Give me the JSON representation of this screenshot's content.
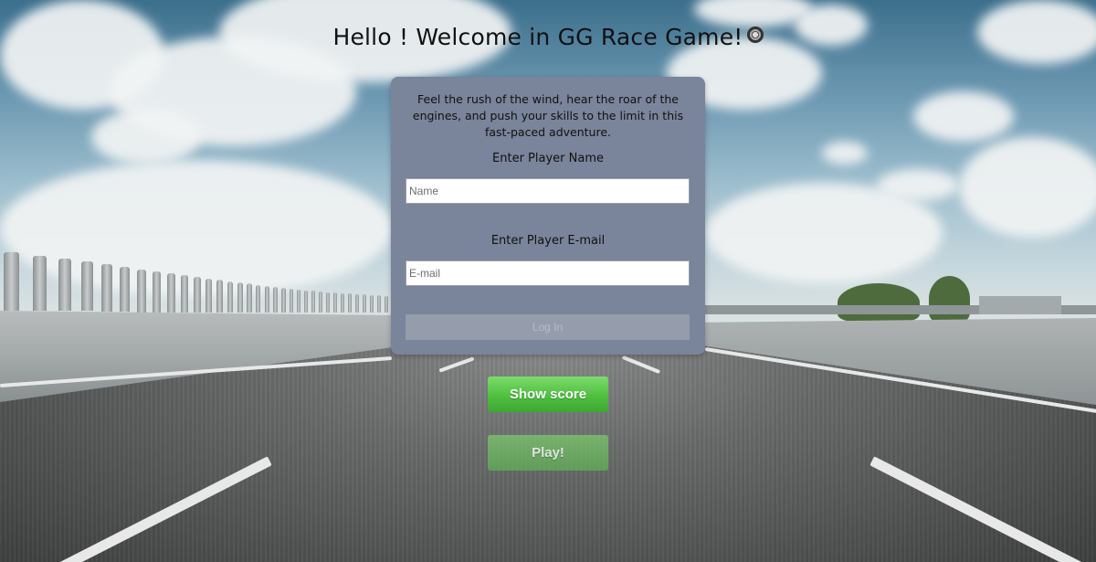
{
  "title": "Hello ! Welcome in GG Race Game!",
  "title_icon": "wheel-icon",
  "panel": {
    "intro": "Feel the rush of the wind, hear the roar of the engines, and push your skills to the limit in this fast-paced adventure.",
    "name_label": "Enter Player Name",
    "name_placeholder": "Name",
    "name_value": "",
    "email_label": "Enter Player E-mail",
    "email_placeholder": "E-mail",
    "email_value": "",
    "login_label": "Log In"
  },
  "buttons": {
    "show_score": "Show score",
    "play": "Play!"
  },
  "colors": {
    "panel_bg": "#7a849a",
    "green_button": "#4fbf3f",
    "disabled_button": "#959cab"
  }
}
